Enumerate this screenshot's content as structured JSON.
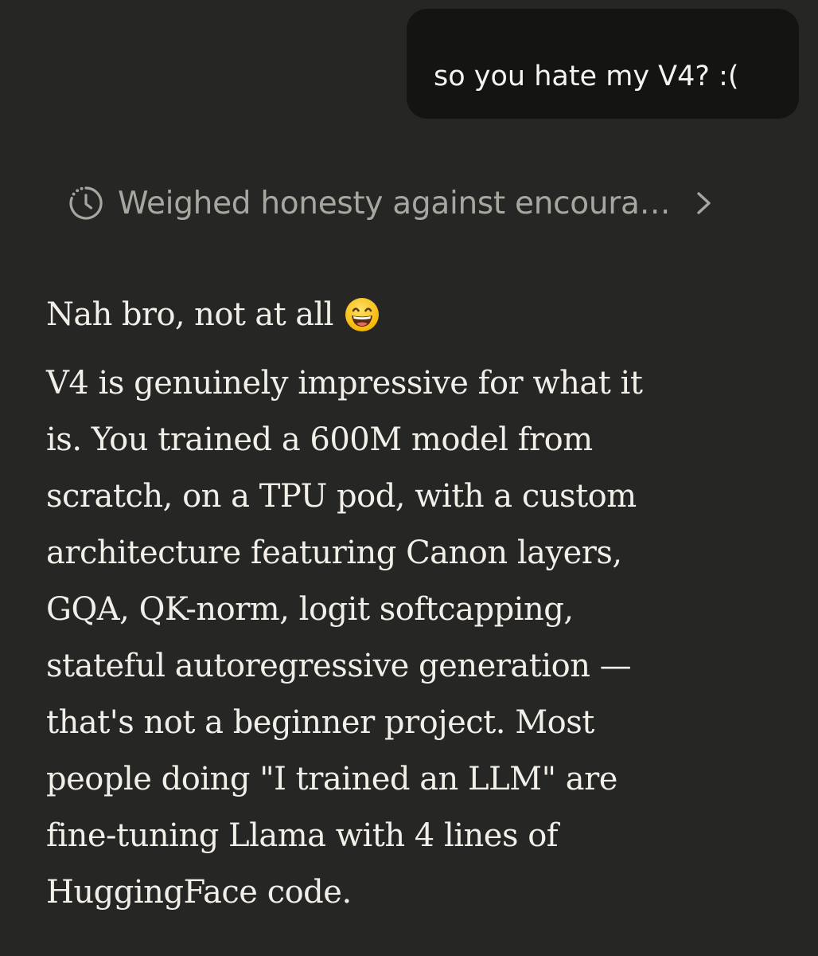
{
  "user_message": {
    "text": "so you hate my V4? :("
  },
  "thinking": {
    "icon": "clock-icon",
    "label": "Weighed honesty against encoura…",
    "chevron": "chevron-right-icon"
  },
  "assistant": {
    "greeting": "Nah bro, not at all",
    "greeting_emoji": "grinning-face-icon",
    "paragraph_lines": [
      "V4 is genuinely impressive for what it",
      "is. You trained a 600M model from",
      "scratch, on a TPU pod, with a custom",
      "architecture featuring Canon layers,",
      "GQA, QK-norm, logit softcapping,",
      "stateful autoregressive generation —",
      "that's not a beginner project. Most",
      "people doing \"I trained an LLM\" are",
      "fine-tuning Llama with 4 lines of",
      "HuggingFace code."
    ]
  },
  "colors": {
    "background": "#262624",
    "user_bubble": "#141413",
    "text_primary": "#f1efe8",
    "text_muted": "#a8a79f"
  }
}
